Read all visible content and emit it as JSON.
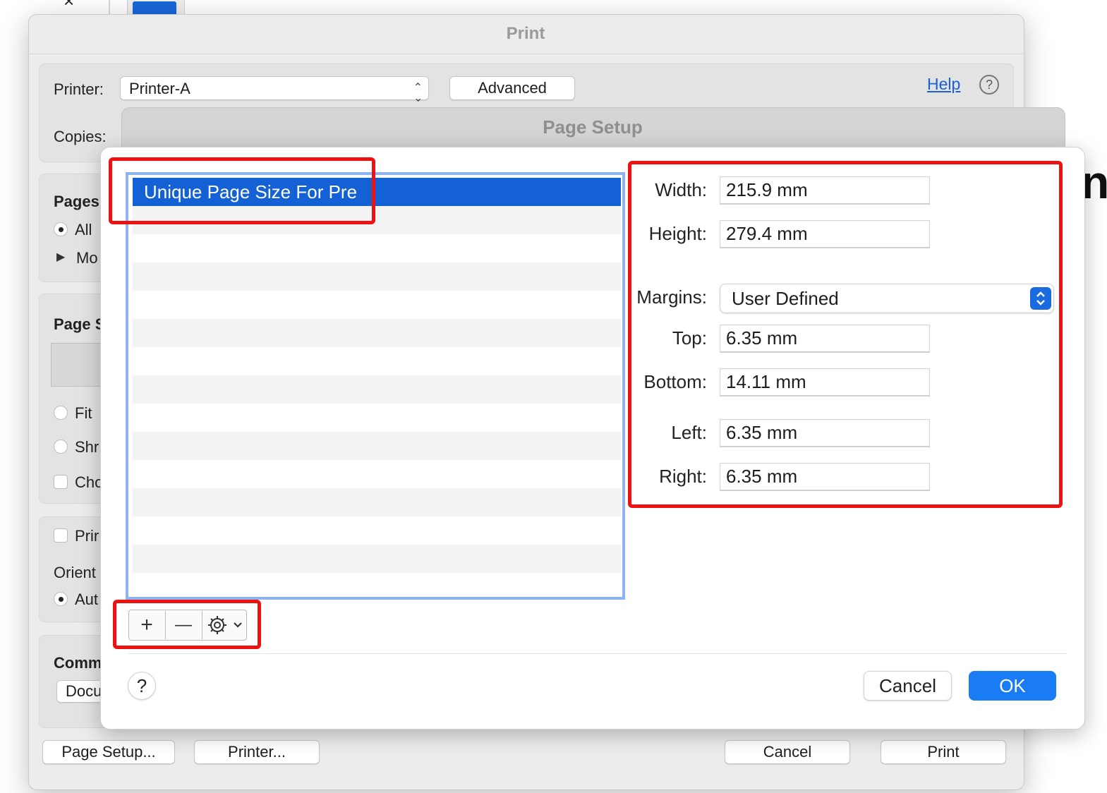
{
  "print_dialog": {
    "title": "Print",
    "printer_label": "Printer:",
    "printer_value": "Printer-A",
    "advanced_button": "Advanced",
    "help_link": "Help",
    "help_icon": "question-circle-icon",
    "copies_label": "Copies:",
    "pages": {
      "heading": "Pages",
      "all": "All",
      "more": "Mo"
    },
    "page_size": {
      "heading": "Page S",
      "fit": "Fit",
      "shrink": "Shr",
      "choose": "Cho"
    },
    "print_check": "Prir",
    "orientation": {
      "label": "Orient",
      "auto": "Aut"
    },
    "comments": {
      "heading": "Comm",
      "value": "Docu"
    },
    "footer": {
      "page_setup_button": "Page Setup...",
      "printer_button": "Printer...",
      "cancel_button": "Cancel",
      "print_button": "Print"
    }
  },
  "page_setup": {
    "title": "Page Setup",
    "list": {
      "selected_item": "Unique Page Size For Pre"
    },
    "toolbar": {
      "add": "+",
      "remove": "—",
      "gear_icon": "gear-icon",
      "chevron_icon": "chevron-down-icon"
    },
    "fields": {
      "width": {
        "label": "Width:",
        "value": "215.9 mm"
      },
      "height": {
        "label": "Height:",
        "value": "279.4 mm"
      },
      "margins": {
        "label": "Margins:",
        "value": "User Defined"
      },
      "top": {
        "label": "Top:",
        "value": "6.35 mm"
      },
      "bottom": {
        "label": "Bottom:",
        "value": "14.11 mm"
      },
      "left": {
        "label": "Left:",
        "value": "6.35 mm"
      },
      "right": {
        "label": "Right:",
        "value": "6.35 mm"
      }
    },
    "help_button": "?",
    "cancel_button": "Cancel",
    "ok_button": "OK"
  },
  "colors": {
    "accent": "#1a7cf5",
    "selection": "#1461d6",
    "annotation_red": "#ee1111"
  },
  "background": {
    "stray_letter": "n",
    "close_glyph": "×"
  }
}
